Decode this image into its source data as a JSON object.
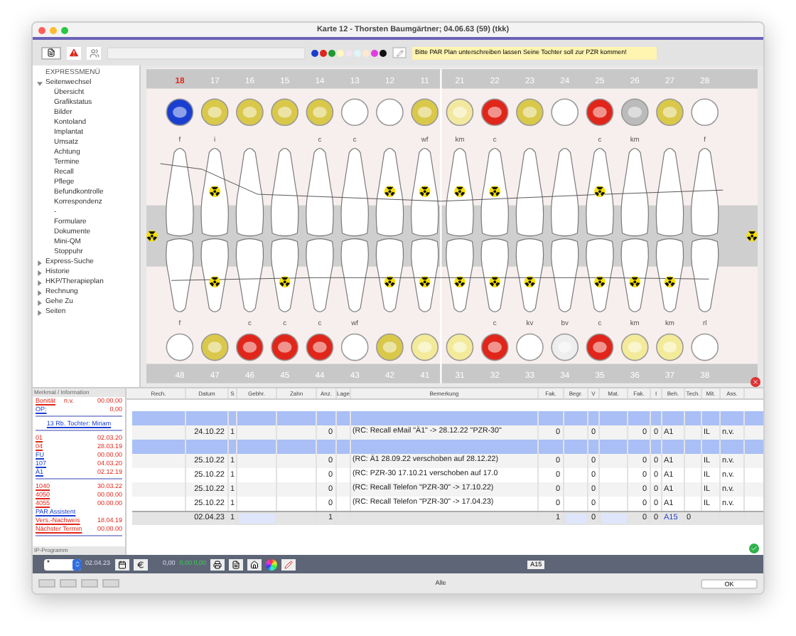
{
  "window": {
    "title": "Karte 12 - Thorsten Baumgärtner; 04.06.63 (59) (tkk)"
  },
  "toolbar": {
    "swatches": [
      {
        "color": "#1a3fd0"
      },
      {
        "color": "#e0261b"
      },
      {
        "color": "#1f9a2e"
      },
      {
        "color": "#fff6c0"
      },
      {
        "color": "#f3e3f0"
      },
      {
        "color": "#dff5f7"
      },
      {
        "color": "#fde9d2"
      },
      {
        "color": "#e33be0"
      },
      {
        "color": "#111111"
      }
    ],
    "note": "Bitte PAR Plan unterschreiben lassen Seine Tochter soll zur PZR kommen!"
  },
  "sidebar": {
    "title": "EXPRESSMENÜ",
    "items": [
      {
        "label": "Seitenwechsel",
        "expanded": true,
        "children": [
          {
            "label": "Übersicht"
          },
          {
            "label": "Grafikstatus"
          },
          {
            "label": "Bilder"
          },
          {
            "label": "Kontoland"
          },
          {
            "label": "Implantat"
          },
          {
            "label": "Umsatz"
          },
          {
            "label": "Achtung"
          },
          {
            "label": "Termine"
          },
          {
            "label": "Recall"
          },
          {
            "label": "Pflege"
          },
          {
            "label": "Befundkontrolle"
          },
          {
            "label": "Korrespondenz"
          },
          {
            "label": "-"
          },
          {
            "label": "Formulare"
          },
          {
            "label": "Dokumente"
          },
          {
            "label": "Mini-QM"
          },
          {
            "label": "Stoppuhr"
          }
        ]
      },
      {
        "label": "Express-Suche",
        "expanded": false
      },
      {
        "label": "Historie",
        "expanded": false
      },
      {
        "label": "HKP/Therapieplan",
        "expanded": false
      },
      {
        "label": "Rechnung",
        "expanded": false
      },
      {
        "label": "Gehe Zu",
        "expanded": false
      },
      {
        "label": "Seiten",
        "expanded": false
      }
    ]
  },
  "chart": {
    "upper_teeth": [
      {
        "number": "18",
        "label": "f",
        "selected": true
      },
      {
        "number": "17",
        "label": "i",
        "selected": false
      },
      {
        "number": "16",
        "selected": false
      },
      {
        "number": "15",
        "selected": false
      },
      {
        "number": "14",
        "label": "c",
        "selected": false
      },
      {
        "number": "13",
        "label": "c",
        "selected": false
      },
      {
        "number": "12",
        "selected": false
      },
      {
        "number": "11",
        "label": "wf",
        "selected": false
      },
      {
        "number": "21",
        "label": "km",
        "selected": false
      },
      {
        "number": "22",
        "label": "c",
        "selected": false
      },
      {
        "number": "23",
        "selected": false
      },
      {
        "number": "24",
        "selected": false
      },
      {
        "number": "25",
        "label": "c",
        "selected": false
      },
      {
        "number": "26",
        "label": "km",
        "selected": false
      },
      {
        "number": "27",
        "selected": false
      },
      {
        "number": "28",
        "label": "f",
        "selected": false
      }
    ],
    "lower_teeth": [
      {
        "number": "48",
        "label": "f",
        "selected": false
      },
      {
        "number": "47",
        "selected": false
      },
      {
        "number": "46",
        "label": "c",
        "selected": false
      },
      {
        "number": "45",
        "label": "c",
        "selected": false
      },
      {
        "number": "44",
        "label": "c",
        "selected": false
      },
      {
        "number": "43",
        "label": "wf",
        "selected": false
      },
      {
        "number": "42",
        "selected": false
      },
      {
        "number": "41",
        "selected": false
      },
      {
        "number": "31",
        "selected": false
      },
      {
        "number": "32",
        "label": "c",
        "selected": false
      },
      {
        "number": "33",
        "label": "kv",
        "selected": false
      },
      {
        "number": "34",
        "label": "bv",
        "selected": false
      },
      {
        "number": "35",
        "label": "c",
        "selected": false
      },
      {
        "number": "36",
        "label": "km",
        "selected": false
      },
      {
        "number": "37",
        "label": "km",
        "selected": false
      },
      {
        "number": "38",
        "label": "rl",
        "selected": false
      }
    ]
  },
  "info_panel": {
    "title": "Merkmal / Information",
    "sections": [
      {
        "rows": [
          {
            "kind": "alert",
            "label": "Bonität",
            "middle": "n.v.",
            "value": "00.00.00"
          },
          {
            "kind": "info",
            "label": "OP:",
            "value": "0,00"
          }
        ]
      },
      {
        "rows": [
          {
            "kind": "link",
            "label": "13 Rb. Tochter: Miriam"
          }
        ]
      },
      {
        "rows": [
          {
            "kind": "alert",
            "label": "01",
            "value": "02.03.20"
          },
          {
            "kind": "alert",
            "label": "04",
            "value": "28.03.19"
          },
          {
            "kind": "info",
            "label": "FU",
            "value": "00.00.00"
          },
          {
            "kind": "info",
            "label": "107",
            "value": "04.03.20"
          },
          {
            "kind": "info",
            "label": "Ä1",
            "value": "02.12.19"
          }
        ]
      },
      {
        "rows": [
          {
            "kind": "alert",
            "label": "1040",
            "value": "30.03.22"
          },
          {
            "kind": "alert",
            "label": "4050",
            "value": "00.00.00"
          },
          {
            "kind": "alert",
            "label": "4055",
            "value": "00.00.00"
          },
          {
            "kind": "link",
            "label": "PAR Assistent"
          },
          {
            "kind": "alert",
            "label": "Vers.-Nachweis",
            "value": "18.04.19"
          },
          {
            "kind": "alert",
            "label": "Nächster Termin",
            "value": "00.00.00"
          }
        ]
      }
    ],
    "footer": "IP-Programm"
  },
  "table": {
    "columns": [
      "Rech.",
      "Datum",
      "S",
      "Gebhr.",
      "Zahn",
      "Anz.",
      "Lage",
      "Bemerkung",
      "Fak.",
      "Begr.",
      "V",
      "Mat.",
      "Fak.",
      "I",
      "Beh.",
      "Tech.",
      "Mit.",
      "Ass."
    ],
    "rows": [
      {
        "kind": "entry",
        "selected": true
      },
      {
        "kind": "entry",
        "selected": false,
        "datum": "24.10.22",
        "s": "1",
        "anz": "0",
        "bemerkung": "(RC: Recall eMail \"Ä1\" -> 28.12.22 \"PZR-30\"",
        "fak": "0",
        "v": "0",
        "fak_2": "0",
        "i": "0",
        "beh": "A1",
        "mit": "IL",
        "ass": "n.v."
      },
      {
        "kind": "entry",
        "selected": true
      },
      {
        "kind": "entry",
        "selected": false,
        "datum": "25.10.22",
        "s": "1",
        "anz": "0",
        "bemerkung": "(RC: Ä1 28.09.22 verschoben auf 28.12.22)",
        "fak": "0",
        "v": "0",
        "fak_2": "0",
        "i": "0",
        "beh": "A1",
        "mit": "IL",
        "ass": "n.v."
      },
      {
        "kind": "entry",
        "selected": false,
        "datum": "25.10.22",
        "s": "1",
        "anz": "0",
        "bemerkung": "(RC: PZR-30 17.10.21 verschoben auf 17.0",
        "fak": "0",
        "v": "0",
        "fak_2": "0",
        "i": "0",
        "beh": "A1",
        "mit": "IL",
        "ass": "n.v."
      },
      {
        "kind": "entry",
        "selected": false,
        "datum": "25.10.22",
        "s": "1",
        "anz": "0",
        "bemerkung": "(RC: Recall Telefon \"PZR-30\" -> 17.10.22)",
        "fak": "0",
        "v": "0",
        "fak_2": "0",
        "i": "0",
        "beh": "A1",
        "mit": "IL",
        "ass": "n.v."
      },
      {
        "kind": "entry",
        "selected": false,
        "datum": "25.10.22",
        "s": "1",
        "anz": "0",
        "bemerkung": "(RC: Recall Telefon \"PZR-30\" -> 17.04.23)",
        "fak": "0",
        "v": "0",
        "fak_2": "0",
        "i": "0",
        "beh": "A1",
        "mit": "IL",
        "ass": "n.v."
      },
      {
        "kind": "new",
        "selected": false,
        "datum": "02.04.23",
        "s": "1",
        "anz": "1",
        "fak": "1",
        "v": "0",
        "fak_2": "0",
        "i": "0",
        "beh": "A15",
        "tech": "0"
      }
    ]
  },
  "entry_bar": {
    "select": "*",
    "date": "02.04.23",
    "amount": "0,00",
    "totals": "0,00 0,00",
    "badge": "A15"
  },
  "footer": {
    "filter": "Alle",
    "ok": "OK"
  }
}
